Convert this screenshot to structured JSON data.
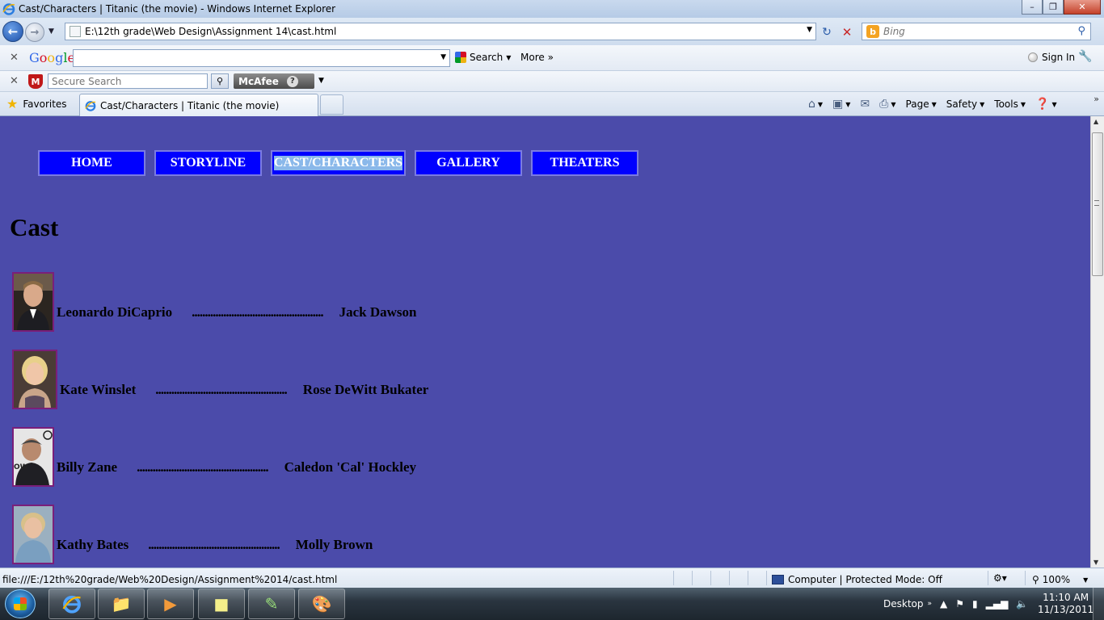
{
  "window": {
    "title": "Cast/Characters | Titanic (the movie) - Windows Internet Explorer",
    "min_label": "–",
    "max_label": "❐",
    "close_label": "✕"
  },
  "addressbar": {
    "url": "E:\\12th grade\\Web Design\\Assignment 14\\cast.html",
    "search_placeholder": "Bing"
  },
  "google_toolbar": {
    "logo": [
      "G",
      "o",
      "o",
      "g",
      "l",
      "e"
    ],
    "search_label": "Search",
    "more_label": "More »",
    "signin_label": "Sign In"
  },
  "mcafee_toolbar": {
    "search_placeholder": "Secure Search",
    "brand": "McAfee",
    "help": "?"
  },
  "favorites_bar": {
    "favorites_label": "Favorites",
    "tab_title": "Cast/Characters | Titanic (the movie)",
    "commands": {
      "page": "Page",
      "safety": "Safety",
      "tools": "Tools"
    }
  },
  "page": {
    "nav": [
      {
        "label": "HOME",
        "selected": false
      },
      {
        "label": "STORYLINE",
        "selected": false
      },
      {
        "label": "CAST/CHARACTERS",
        "selected": true
      },
      {
        "label": "GALLERY",
        "selected": false
      },
      {
        "label": "THEATERS",
        "selected": false
      }
    ],
    "heading": "Cast",
    "cast": [
      {
        "actor": "Leonardo DiCaprio",
        "dots": "..................................................",
        "role": "Jack Dawson"
      },
      {
        "actor": "Kate Winslet",
        "dots": "..................................................",
        "role": "Rose DeWitt Bukater"
      },
      {
        "actor": "Billy Zane",
        "dots": "..................................................",
        "role": "Caledon 'Cal' Hockley"
      },
      {
        "actor": "Kathy Bates",
        "dots": "..................................................",
        "role": "Molly Brown"
      }
    ]
  },
  "statusbar": {
    "url": "file:///E:/12th%20grade/Web%20Design/Assignment%2014/cast.html",
    "zone": "Computer | Protected Mode: Off",
    "zoom": "100%"
  },
  "taskbar": {
    "desktop_label": "Desktop",
    "time": "11:10 AM",
    "date": "11/13/2011"
  },
  "colors": {
    "page_bg": "#4b4baa",
    "nav_bg": "#0000ff",
    "selection": "#8ab8ea",
    "photo_border": "#7a1f7a"
  }
}
